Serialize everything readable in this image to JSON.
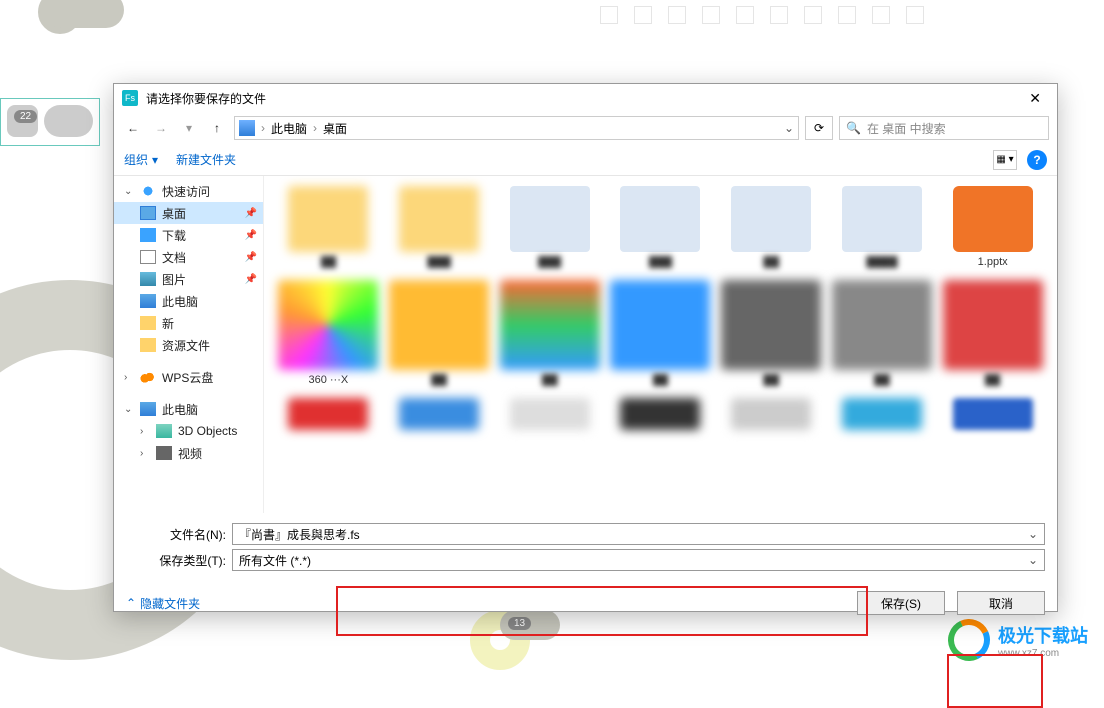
{
  "bg": {
    "thumb_badges": [
      "22",
      "13"
    ]
  },
  "logo": {
    "title": "极光下载站",
    "sub": "www.xz7.com"
  },
  "dialog": {
    "title": "请选择你要保存的文件",
    "nav": {
      "path": [
        "此电脑",
        "桌面"
      ],
      "search_placeholder": "在 桌面 中搜索"
    },
    "toolbar": {
      "organize": "组织",
      "new_folder": "新建文件夹"
    },
    "tree": {
      "quick_access": "快速访问",
      "items": [
        {
          "label": "桌面",
          "selected": true
        },
        {
          "label": "下载"
        },
        {
          "label": "文档"
        },
        {
          "label": "图片"
        },
        {
          "label": "此电脑"
        },
        {
          "label": "新"
        },
        {
          "label": "资源文件"
        }
      ],
      "wps": "WPS云盘",
      "this_pc": "此电脑",
      "pc_items": [
        {
          "label": "3D Objects"
        },
        {
          "label": "视频"
        }
      ]
    },
    "files": {
      "r1": [
        "",
        "",
        "",
        "",
        "",
        "",
        "1.pptx"
      ],
      "r2_labels": [
        "360 ···X",
        "",
        "",
        "",
        "",
        "",
        ""
      ]
    },
    "form": {
      "filename_label": "文件名(N):",
      "filename_value": "『尚書』成長與思考.fs",
      "type_label": "保存类型(T):",
      "type_value": "所有文件 (*.*)",
      "hide_folders": "隐藏文件夹",
      "save": "保存(S)",
      "cancel": "取消"
    }
  }
}
